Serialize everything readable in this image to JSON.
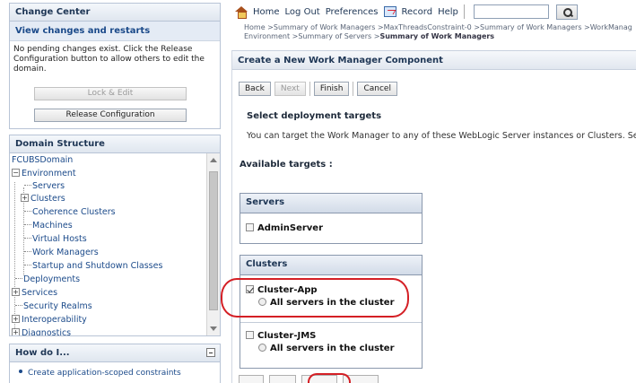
{
  "change_center": {
    "title": "Change Center",
    "link": "View changes and restarts",
    "message": "No pending changes exist. Click the Release Configuration button to allow others to edit the domain.",
    "lock_label": "Lock & Edit",
    "release_label": "Release Configuration"
  },
  "domain_structure": {
    "title": "Domain Structure",
    "items": {
      "root": "FCUBSDomain",
      "environment": "Environment",
      "servers": "Servers",
      "clusters": "Clusters",
      "coherence": "Coherence Clusters",
      "machines": "Machines",
      "virtual_hosts": "Virtual Hosts",
      "work_managers": "Work Managers",
      "startup": "Startup and Shutdown Classes",
      "deployments": "Deployments",
      "services": "Services",
      "security": "Security Realms",
      "interop": "Interoperability",
      "diagnostics": "Diagnostics"
    }
  },
  "how_do_i": {
    "title": "How do I...",
    "item": "Create application-scoped constraints"
  },
  "toolbar": {
    "home": "Home",
    "logout": "Log Out",
    "preferences": "Preferences",
    "record": "Record",
    "help": "Help",
    "search_value": ""
  },
  "breadcrumb": {
    "line1": "Home >Summary of Work Managers >MaxThreadsConstraint-0 >Summary of Work Managers >WorkManag",
    "line2_prefix": "Environment >Summary of Servers >",
    "line2_current": "Summary of Work Managers"
  },
  "main": {
    "title": "Create a New Work Manager Component",
    "buttons": {
      "back": "Back",
      "next": "Next",
      "finish": "Finish",
      "cancel": "Cancel"
    },
    "section_title": "Select deployment targets",
    "description": "You can target the Work Manager to any of these WebLogic Server instances or Clusters. Select t",
    "available_targets": "Available targets :",
    "servers_table": {
      "header": "Servers",
      "rows": [
        "AdminServer"
      ]
    },
    "clusters_table": {
      "header": "Clusters",
      "rows": [
        {
          "name": "Cluster-App",
          "checked": true,
          "option": "All servers in the cluster"
        },
        {
          "name": "Cluster-JMS",
          "checked": false,
          "option": "All servers in the cluster"
        }
      ]
    }
  },
  "colors": {
    "accent_red": "#d41f25",
    "link_blue": "#1b4a8a",
    "header_navy": "#1e3655"
  }
}
